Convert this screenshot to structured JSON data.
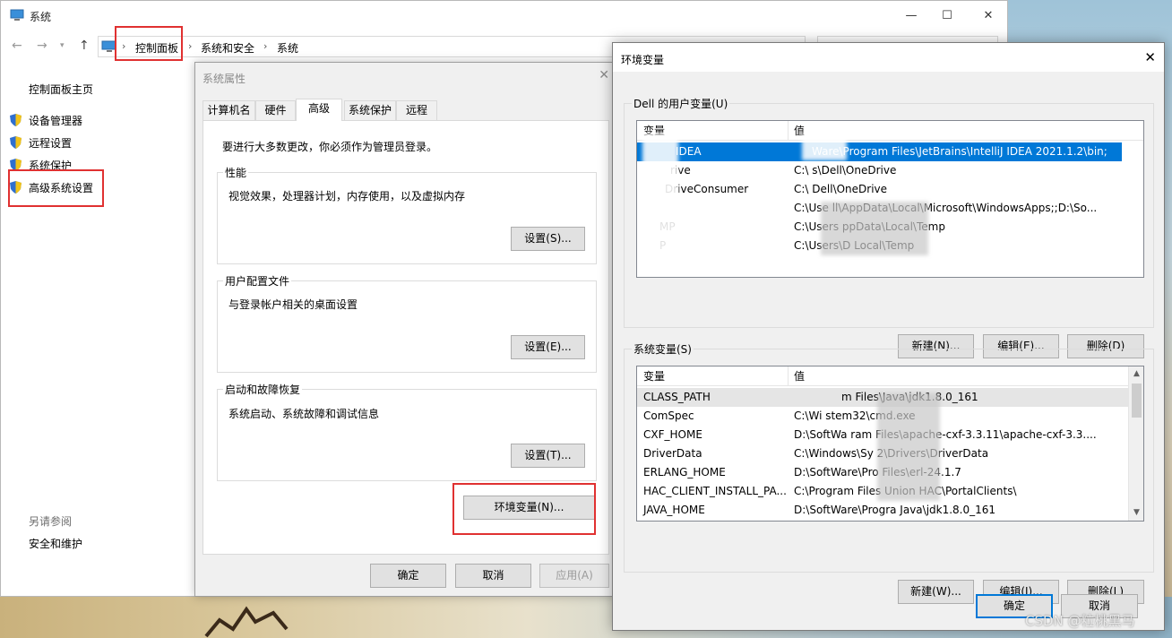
{
  "window": {
    "title": "系统",
    "controls": {
      "minimize": "—",
      "maximize": "☐",
      "close": "✕"
    }
  },
  "address_bar": {
    "crumbs": [
      "控制面板",
      "系统和安全",
      "系统"
    ]
  },
  "sidebar": {
    "home": "控制面板主页",
    "items": [
      {
        "label": "设备管理器",
        "icon": "shield-icon"
      },
      {
        "label": "远程设置",
        "icon": "shield-icon"
      },
      {
        "label": "系统保护",
        "icon": "shield-icon"
      },
      {
        "label": "高级系统设置",
        "icon": "shield-icon"
      }
    ],
    "see_also_title": "另请参阅",
    "see_also_items": [
      "安全和维护"
    ]
  },
  "system_properties": {
    "title": "系统属性",
    "tabs": [
      "计算机名",
      "硬件",
      "高级",
      "系统保护",
      "远程"
    ],
    "active_tab": "高级",
    "admin_note": "要进行大多数更改，你必须作为管理员登录。",
    "groups": [
      {
        "title": "性能",
        "description": "视觉效果，处理器计划，内存使用，以及虚拟内存",
        "button": "设置(S)..."
      },
      {
        "title": "用户配置文件",
        "description": "与登录帐户相关的桌面设置",
        "button": "设置(E)..."
      },
      {
        "title": "启动和故障恢复",
        "description": "系统启动、系统故障和调试信息",
        "button": "设置(T)..."
      }
    ],
    "env_button": "环境变量(N)...",
    "ok": "确定",
    "cancel": "取消",
    "apply": "应用(A)"
  },
  "env_vars": {
    "title": "环境变量",
    "close": "✕",
    "user_section": {
      "title": "Dell 的用户变量(U)",
      "columns": [
        "变量",
        "值"
      ],
      "rows": [
        {
          "name": "IDEA",
          "value": "Ware\\Program Files\\JetBrains\\IntelliJ IDEA 2021.1.2\\bin;"
        },
        {
          "name": "rive",
          "value": "C:\\    s\\Dell\\OneDrive"
        },
        {
          "name": "DriveConsumer",
          "value": "C:\\    Dell\\OneDrive"
        },
        {
          "name": "",
          "value": "C:\\Use     ll\\AppData\\Local\\Microsoft\\WindowsApps;;D:\\So..."
        },
        {
          "name": "MP",
          "value": "C:\\Users     ppData\\Local\\Temp"
        },
        {
          "name": "P",
          "value": "C:\\Users\\D       Local\\Temp"
        }
      ],
      "buttons": [
        "新建(N)...",
        "编辑(E)...",
        "删除(D)"
      ]
    },
    "system_section": {
      "title": "系统变量(S)",
      "columns": [
        "变量",
        "值"
      ],
      "rows": [
        {
          "name": "CLASS_PATH",
          "value": "m Files\\Java\\jdk1.8.0_161"
        },
        {
          "name": "ComSpec",
          "value": "C:\\Wi       stem32\\cmd.exe"
        },
        {
          "name": "CXF_HOME",
          "value": "D:\\SoftWa      ram Files\\apache-cxf-3.3.11\\apache-cxf-3.3...."
        },
        {
          "name": "DriverData",
          "value": "C:\\Windows\\Sy     2\\Drivers\\DriverData"
        },
        {
          "name": "ERLANG_HOME",
          "value": "D:\\SoftWare\\Pro     Files\\erl-24.1.7"
        },
        {
          "name": "HAC_CLIENT_INSTALL_PA...",
          "value": "C:\\Program Files      Union HAC\\PortalClients\\"
        },
        {
          "name": "JAVA_HOME",
          "value": "D:\\SoftWare\\Progra     Java\\jdk1.8.0_161"
        }
      ],
      "buttons": [
        "新建(W)...",
        "编辑(I)...",
        "删除(L)"
      ]
    },
    "ok": "确定",
    "cancel": "取消"
  },
  "watermark": "CSDN @粒桃黑马",
  "colors": {
    "highlight_red": "#e03131",
    "selection_blue": "#0078d7"
  }
}
